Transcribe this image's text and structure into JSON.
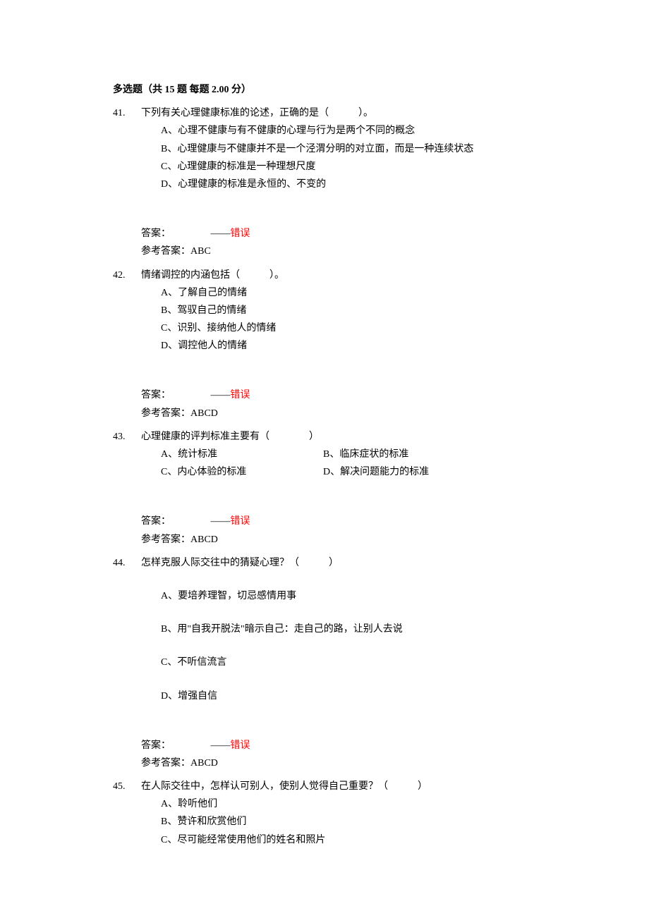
{
  "section_title": "多选题（共 15 题 每题 2.00 分）",
  "answer_label": "答案：",
  "status_prefix": "——",
  "status_wrong": "错误",
  "ref_label": "参考答案：",
  "questions": [
    {
      "num": "41.",
      "stem": "下列有关心理健康标准的论述，正确的是（　　　）。",
      "options": [
        "A、心理不健康与有不健康的心理与行为是两个不同的概念",
        "B、心理健康与不健康并不是一个泾渭分明的对立面，而是一种连续状态",
        "C、心理健康的标准是一种理想尺度",
        "D、心理健康的标准是永恒的、不变的"
      ],
      "ref_answer": "ABC"
    },
    {
      "num": "42.",
      "stem": "情绪调控的内涵包括（　　　）。",
      "options": [
        "A、了解自己的情绪",
        "B、驾驭自己的情绪",
        "C、识别、接纳他人的情绪",
        "D、调控他人的情绪"
      ],
      "ref_answer": "ABCD"
    },
    {
      "num": "43.",
      "stem": "心理健康的评判标准主要有（　　　　）",
      "options_two_col": [
        {
          "left": "A、统计标准",
          "right": "B、临床症状的标准"
        },
        {
          "left": "C、内心体验的标准",
          "right": "D、解决问题能力的标准"
        }
      ],
      "ref_answer": "ABCD"
    },
    {
      "num": "44.",
      "stem": "怎样克服人际交往中的猜疑心理？（　　　）",
      "options": [
        "A、要培养理智，切忌感情用事",
        "B、用\"自我开脱法\"暗示自己：走自己的路，让别人去说",
        "C、不听信流言",
        "D、增强自信"
      ],
      "spaced": true,
      "ref_answer": "ABCD"
    },
    {
      "num": "45.",
      "stem": "在人际交往中，怎样认可别人，使别人觉得自己重要？（　　　）",
      "options": [
        "A、聆听他们",
        "B、赞许和欣赏他们",
        "C、尽可能经常使用他们的姓名和照片"
      ],
      "no_answer_block": true
    }
  ]
}
